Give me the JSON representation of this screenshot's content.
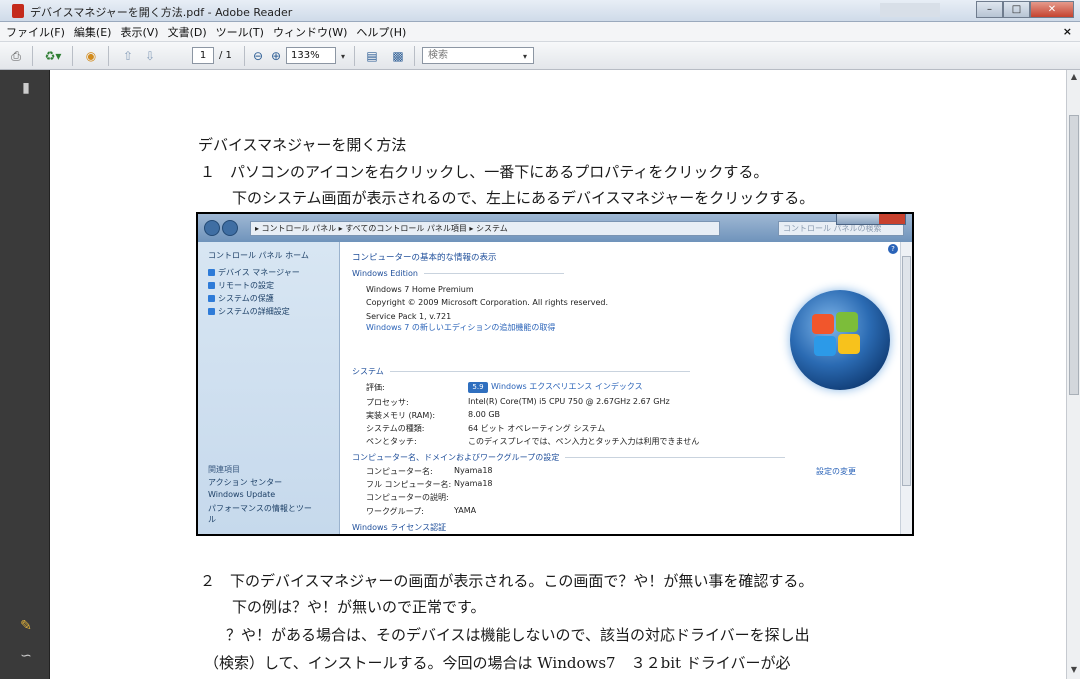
{
  "window": {
    "title": "デバイスマネジャーを開く方法.pdf - Adobe Reader",
    "close_doc": "×"
  },
  "menu": [
    "ファイル(F)",
    "編集(E)",
    "表示(V)",
    "文書(D)",
    "ツール(T)",
    "ウィンドウ(W)",
    "ヘルプ(H)"
  ],
  "toolbar": {
    "page_current": "1",
    "page_total": "/ 1",
    "zoom": "133%",
    "search_placeholder": "検索"
  },
  "document": {
    "heading": "デバイスマネジャーを開く方法",
    "step1_line1": "１　パソコンのアイコンを右クリックし、一番下にあるプロパティをクリックする。",
    "step1_line2": "下のシステム画面が表示されるので、左上にあるデバイスマネジャーをクリックする。",
    "step2_line1": "２　下のデバイスマネジャーの画面が表示される。この画面で？や！が無い事を確認する。",
    "step2_line2": "下の例は？や！が無いので正常です。",
    "step2_line3": "？や！がある場合は、そのデバイスは機能しないので、該当の対応ドライバーを探し出",
    "step2_line4": "（検索）して、インストールする。今回の場合は Windows7　３２bit ドライバーが必"
  },
  "screenshot": {
    "address": "▸ コントロール パネル ▸ すべてのコントロール パネル項目 ▸ システム",
    "search": "コントロール パネルの検索",
    "left_pane": {
      "home": "コントロール パネル ホーム",
      "links": [
        "デバイス マネージャー",
        "リモートの設定",
        "システムの保護",
        "システムの詳細設定"
      ],
      "related_head": "関連項目",
      "related": [
        "アクション センター",
        "Windows Update",
        "パフォーマンスの情報とツー",
        "ル"
      ]
    },
    "main": {
      "title": "コンピューターの基本的な情報の表示",
      "edition_head": "Windows Edition",
      "edition": "Windows 7 Home Premium",
      "copyright": "Copyright © 2009 Microsoft Corporation.  All rights reserved.",
      "sp": "Service Pack 1, v.721",
      "more": "Windows 7 の新しいエディションの追加機能の取得",
      "system_head": "システム",
      "rows": [
        {
          "k": "評価:",
          "v": "Windows エクスペリエンス インデックス"
        },
        {
          "k": "プロセッサ:",
          "v": "Intel(R) Core(TM) i5 CPU       750  @ 2.67GHz   2.67 GHz"
        },
        {
          "k": "実装メモリ (RAM):",
          "v": "8.00 GB"
        },
        {
          "k": "システムの種類:",
          "v": "64 ビット オペレーティング システム"
        },
        {
          "k": "ペンとタッチ:",
          "v": "このディスプレイでは、ペン入力とタッチ入力は利用できません"
        }
      ],
      "rating_badge": "5.9",
      "comp_head": "コンピューター名、ドメインおよびワークグループの設定",
      "comp_rows": [
        {
          "k": "コンピューター名:",
          "v": "Nyama18"
        },
        {
          "k": "フル コンピューター名:",
          "v": "Nyama18"
        },
        {
          "k": "コンピューターの説明:",
          "v": ""
        },
        {
          "k": "ワークグループ:",
          "v": "YAMA"
        }
      ],
      "change": "設定の変更",
      "license_head": "Windows ライセンス認証"
    }
  }
}
